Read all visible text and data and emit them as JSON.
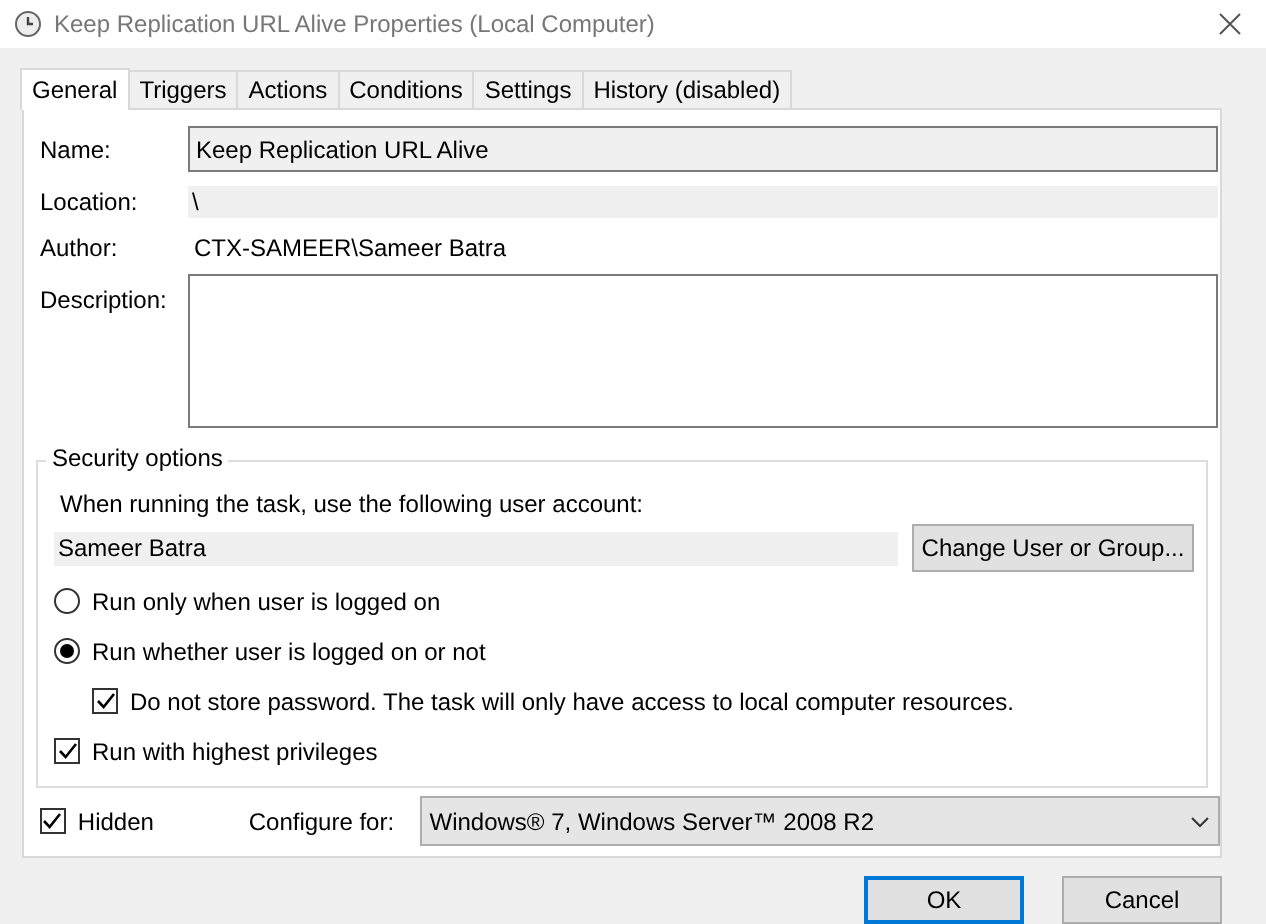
{
  "window": {
    "title": "Keep Replication URL Alive Properties (Local Computer)"
  },
  "tabs": [
    {
      "label": "General",
      "selected": true
    },
    {
      "label": "Triggers",
      "selected": false
    },
    {
      "label": "Actions",
      "selected": false
    },
    {
      "label": "Conditions",
      "selected": false
    },
    {
      "label": "Settings",
      "selected": false
    },
    {
      "label": "History (disabled)",
      "selected": false
    }
  ],
  "general": {
    "name_label": "Name:",
    "name": "Keep Replication URL Alive",
    "location_label": "Location:",
    "location": "\\",
    "author_label": "Author:",
    "author": "CTX-SAMEER\\Sameer Batra",
    "description_label": "Description:"
  },
  "security": {
    "legend": "Security options",
    "prompt": "When running the task, use the following user account:",
    "account": "Sameer Batra",
    "change_button": "Change User or Group...",
    "options": [
      {
        "kind": "radio",
        "label": "Run only when user is logged on",
        "selected": false
      },
      {
        "kind": "radio",
        "label": "Run whether user is logged on or not",
        "selected": true,
        "children": [
          {
            "kind": "checkbox",
            "label": "Do not store password.  The task will only have access to local computer resources.",
            "checked": true
          }
        ]
      },
      {
        "kind": "checkbox",
        "label": "Run with highest privileges",
        "checked": true
      }
    ]
  },
  "hidden": {
    "label": "Hidden",
    "checked": true
  },
  "configure": {
    "label": "Configure for:",
    "value": "Windows® 7, Windows Server™ 2008 R2"
  },
  "buttons": [
    {
      "label": "OK",
      "default": true
    },
    {
      "label": "Cancel",
      "default": false
    }
  ]
}
